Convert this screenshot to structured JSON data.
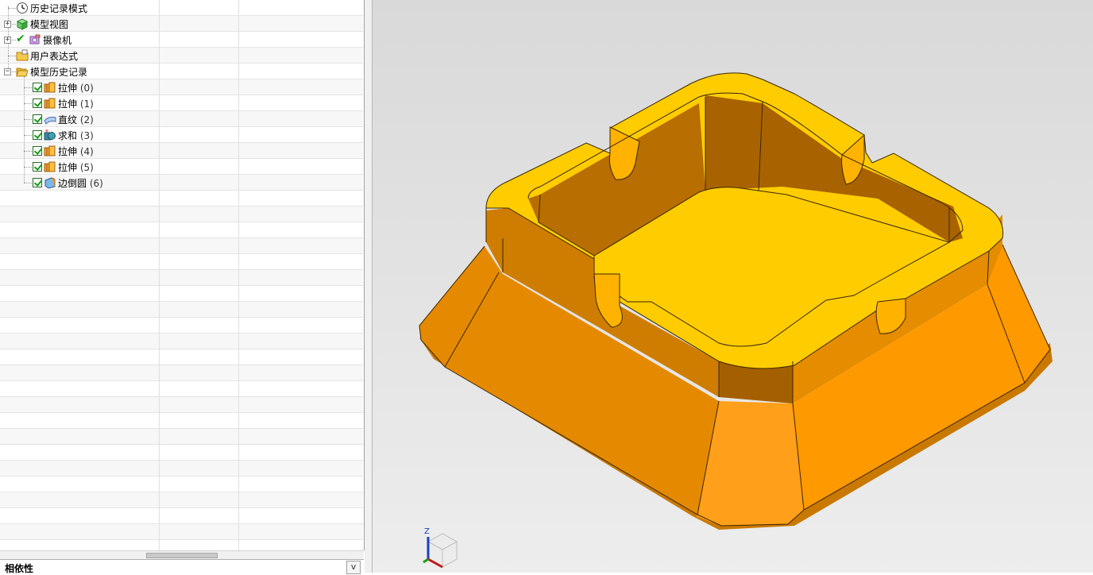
{
  "navigator": {
    "nodes": [
      {
        "label": "历史记录模式",
        "num": "",
        "icon": "clock-icon",
        "expander": "",
        "check": false
      },
      {
        "label": "模型视图",
        "num": "",
        "icon": "model-views-icon",
        "expander": "+",
        "check": false
      },
      {
        "label": "摄像机",
        "num": "",
        "icon": "camera-icon",
        "expander": "+",
        "check": false
      },
      {
        "label": "用户表达式",
        "num": "",
        "icon": "folder-icon",
        "expander": "",
        "check": false
      },
      {
        "label": "模型历史记录",
        "num": "",
        "icon": "folder-open-icon",
        "expander": "−",
        "check": false
      },
      {
        "label": "拉伸 ",
        "num": "(0)",
        "icon": "extrude-icon",
        "expander": "",
        "check": true
      },
      {
        "label": "拉伸 ",
        "num": "(1)",
        "icon": "extrude-icon",
        "expander": "",
        "check": true
      },
      {
        "label": "直纹 ",
        "num": "(2)",
        "icon": "ruled-icon",
        "expander": "",
        "check": true
      },
      {
        "label": "求和 ",
        "num": "(3)",
        "icon": "unite-icon",
        "expander": "",
        "check": true
      },
      {
        "label": "拉伸 ",
        "num": "(4)",
        "icon": "extrude-icon",
        "expander": "",
        "check": true
      },
      {
        "label": "拉伸 ",
        "num": "(5)",
        "icon": "extrude-icon",
        "expander": "",
        "check": true
      },
      {
        "label": "边倒圆 ",
        "num": "(6)",
        "icon": "edge-blend-icon",
        "expander": "",
        "check": true
      }
    ]
  },
  "dependencies": {
    "title": "相依性"
  },
  "viewport": {
    "triad_z_label": "Z",
    "colors": {
      "top_face": "#ffcc00",
      "side_light": "#ff9900",
      "side_dark": "#e08600",
      "inner_wall": "#b86e00"
    }
  }
}
